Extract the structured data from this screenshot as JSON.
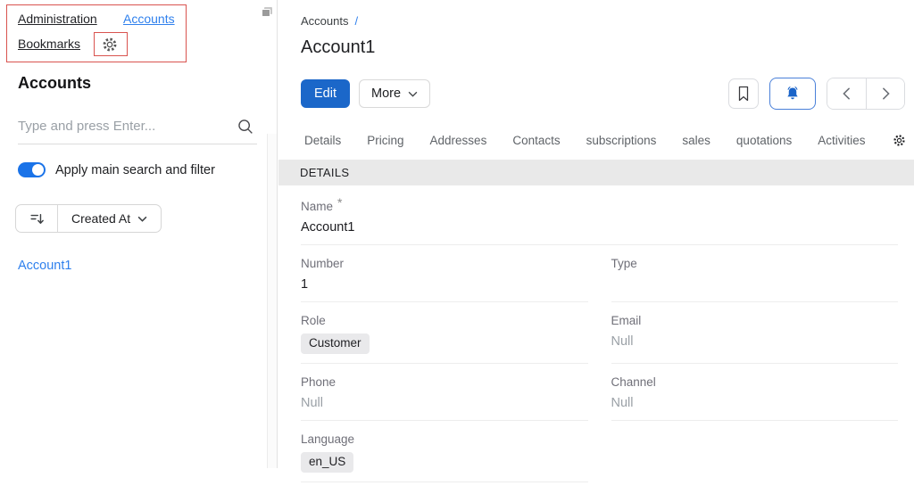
{
  "colors": {
    "accent_blue": "#1b67c9",
    "link_blue": "#2f80ed",
    "toggle_blue": "#1a73e8",
    "annotation_red": "#d9534f",
    "section_bar_bg": "#e9e9e9"
  },
  "icons": [
    "gear-icon",
    "panels-icon",
    "search-icon",
    "sort-descending-icon",
    "chevron-down-icon",
    "bookmark-icon",
    "bell-icon",
    "chevron-left-icon",
    "chevron-right-icon"
  ],
  "sidebar": {
    "nav_links": {
      "administration": "Administration",
      "accounts": "Accounts",
      "bookmarks": "Bookmarks"
    },
    "heading": "Accounts",
    "search_placeholder": "Type and press Enter...",
    "toggle_label": "Apply main search and filter",
    "toggle_state": "on",
    "sort_field": "Created At",
    "results": [
      "Account1"
    ]
  },
  "main": {
    "breadcrumb_root": "Accounts",
    "breadcrumb_separator": "/",
    "title": "Account1",
    "edit_label": "Edit",
    "more_label": "More",
    "tabs": [
      "Details",
      "Pricing",
      "Addresses",
      "Contacts",
      "subscriptions",
      "sales",
      "quotations",
      "Activities"
    ],
    "section_title": "DETAILS",
    "fields": [
      {
        "label": "Name",
        "required_marker": "*",
        "value": "Account1"
      },
      {
        "label": "Number",
        "value": "1"
      },
      {
        "label": "Type",
        "value": ""
      },
      {
        "label": "Role",
        "value": "Customer"
      },
      {
        "label": "Email",
        "value": "Null"
      },
      {
        "label": "Phone",
        "value": "Null"
      },
      {
        "label": "Channel",
        "value": "Null"
      },
      {
        "label": "Language",
        "value": "en_US"
      }
    ]
  }
}
